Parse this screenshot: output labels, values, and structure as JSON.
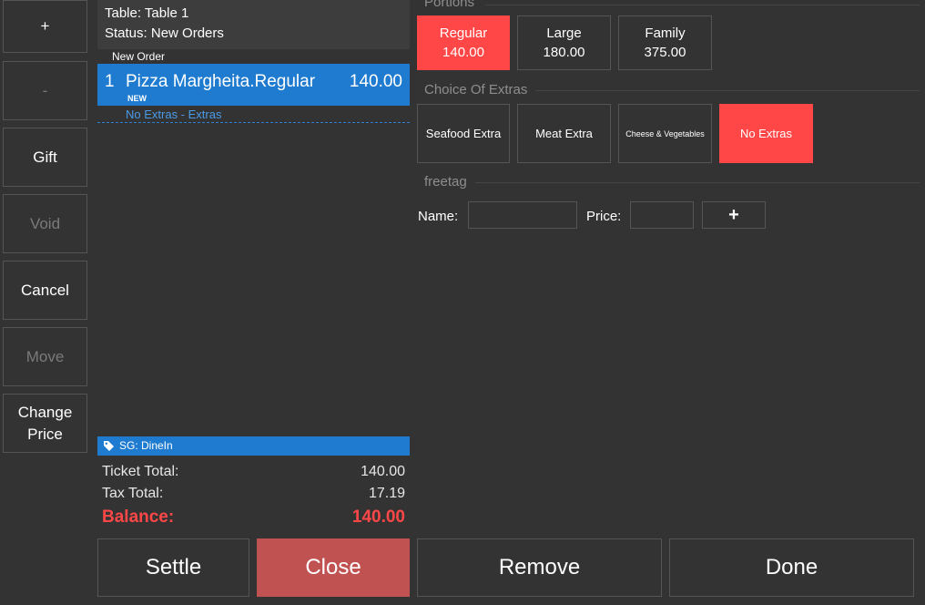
{
  "side": {
    "plus_label": "+",
    "minus_label": "-",
    "gift_label": "Gift",
    "void_label": "Void",
    "cancel_label": "Cancel",
    "move_label": "Move",
    "change_price_label": "Change\nPrice"
  },
  "ticket": {
    "table_text": "Table: Table 1",
    "status_text": "Status: New Orders",
    "group_label": "New Order",
    "order": {
      "qty": "1",
      "name": "Pizza Margheita.Regular",
      "price": "140.00",
      "tag": "NEW",
      "extras": "No Extras - Extras"
    },
    "service_group": "SG: DineIn",
    "totals": {
      "ticket_total_label": "Ticket Total:",
      "ticket_total_value": "140.00",
      "tax_total_label": "Tax Total:",
      "tax_total_value": "17.19",
      "balance_label": "Balance:",
      "balance_value": "140.00"
    }
  },
  "bottom": {
    "settle_label": "Settle",
    "close_label": "Close",
    "remove_label": "Remove",
    "done_label": "Done"
  },
  "portions": {
    "title": "Portions",
    "items": [
      {
        "name": "Regular",
        "price": "140.00",
        "selected": true
      },
      {
        "name": "Large",
        "price": "180.00",
        "selected": false
      },
      {
        "name": "Family",
        "price": "375.00",
        "selected": false
      }
    ]
  },
  "extras": {
    "title": "Choice Of Extras",
    "items": [
      {
        "name": "Seafood Extra",
        "selected": false
      },
      {
        "name": "Meat Extra",
        "selected": false
      },
      {
        "name": "Cheese & Vegetables",
        "selected": false
      },
      {
        "name": "No Extras",
        "selected": true
      }
    ]
  },
  "freetag": {
    "title": "freetag",
    "name_label": "Name:",
    "price_label": "Price:",
    "add_label": "+"
  },
  "colors": {
    "accent_red": "#ff4747",
    "accent_blue": "#1e7bcf",
    "close_button": "#c05252"
  }
}
